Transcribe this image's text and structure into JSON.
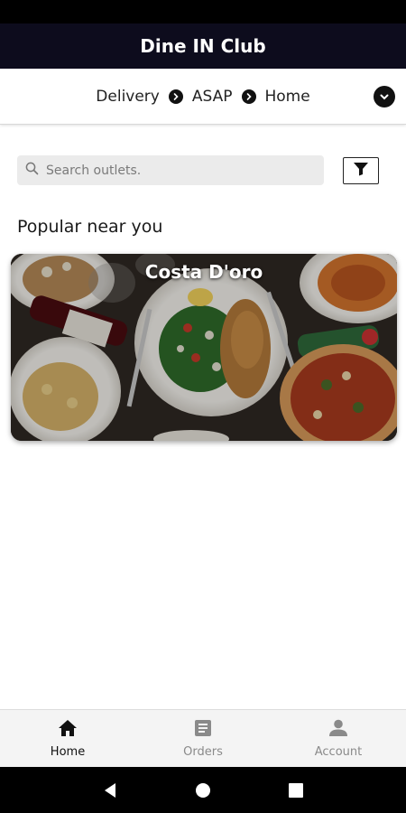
{
  "app": {
    "title": "Dine IN Club"
  },
  "crumbs": {
    "mode": "Delivery",
    "time": "ASAP",
    "address": "Home"
  },
  "search": {
    "placeholder": "Search outlets."
  },
  "section": {
    "title": "Popular near you"
  },
  "outlets": [
    {
      "name": "Costa D'oro"
    }
  ],
  "bottom_nav": {
    "items": [
      {
        "label": "Home",
        "icon": "home-icon",
        "active": true
      },
      {
        "label": "Orders",
        "icon": "orders-icon",
        "active": false
      },
      {
        "label": "Account",
        "icon": "account-icon",
        "active": false
      }
    ]
  },
  "colors": {
    "app_bar": "#0d0c1d",
    "accent": "#111111",
    "inactive": "#8a8a8a"
  }
}
